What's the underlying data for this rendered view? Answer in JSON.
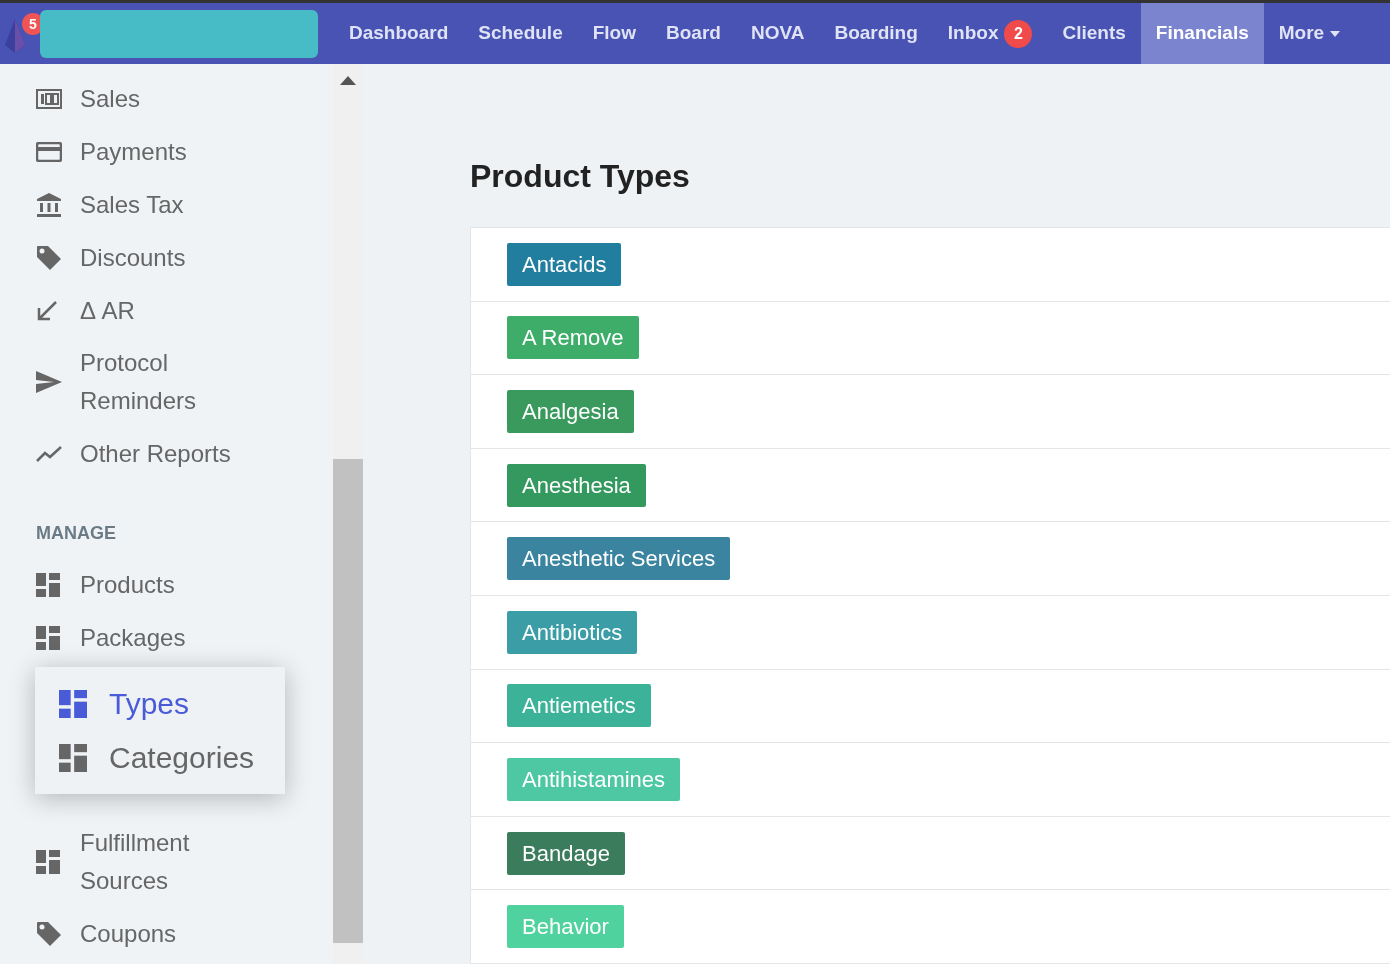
{
  "header": {
    "logo_badge": "5",
    "nav": [
      {
        "label": "Dashboard",
        "selected": false
      },
      {
        "label": "Schedule",
        "selected": false
      },
      {
        "label": "Flow",
        "selected": false
      },
      {
        "label": "Board",
        "selected": false
      },
      {
        "label": "NOVA",
        "selected": false
      },
      {
        "label": "Boarding",
        "selected": false
      },
      {
        "label": "Inbox",
        "badge": "2",
        "selected": false
      },
      {
        "label": "Clients",
        "selected": false
      },
      {
        "label": "Financials",
        "selected": true
      },
      {
        "label": "More",
        "dropdown": true,
        "selected": false
      }
    ]
  },
  "sidebar": {
    "reports": [
      {
        "label": "Sales",
        "kind": "counter"
      },
      {
        "label": "Payments",
        "kind": "card"
      },
      {
        "label": "Sales Tax",
        "kind": "bank"
      },
      {
        "label": "Discounts",
        "kind": "tag"
      },
      {
        "label": "Δ AR",
        "kind": "arrow"
      },
      {
        "label": "Protocol Reminders",
        "kind": "send"
      },
      {
        "label": "Other Reports",
        "kind": "chart"
      }
    ],
    "manage_heading": "MANAGE",
    "manage": [
      {
        "label": "Products",
        "kind": "grid"
      },
      {
        "label": "Packages",
        "kind": "grid",
        "children": [
          {
            "label": "Types",
            "selected": true
          },
          {
            "label": "Categories",
            "selected": false
          }
        ]
      },
      {
        "label": "Fulfillment Sources",
        "kind": "grid"
      },
      {
        "label": "Coupons",
        "kind": "tag"
      }
    ]
  },
  "main": {
    "title": "Product Types",
    "types": [
      {
        "label": "Antacids",
        "color": "#217e9e"
      },
      {
        "label": "A Remove",
        "color": "#3ead6a"
      },
      {
        "label": "Analgesia",
        "color": "#3a995c"
      },
      {
        "label": "Anesthesia",
        "color": "#34995e"
      },
      {
        "label": "Anesthetic Services",
        "color": "#3a84a0"
      },
      {
        "label": "Antibiotics",
        "color": "#3b9ea6"
      },
      {
        "label": "Antiemetics",
        "color": "#3cb398"
      },
      {
        "label": "Antihistamines",
        "color": "#4dc8a2"
      },
      {
        "label": "Bandage",
        "color": "#3a7c5c"
      },
      {
        "label": "Behavior",
        "color": "#50d29e"
      }
    ]
  }
}
